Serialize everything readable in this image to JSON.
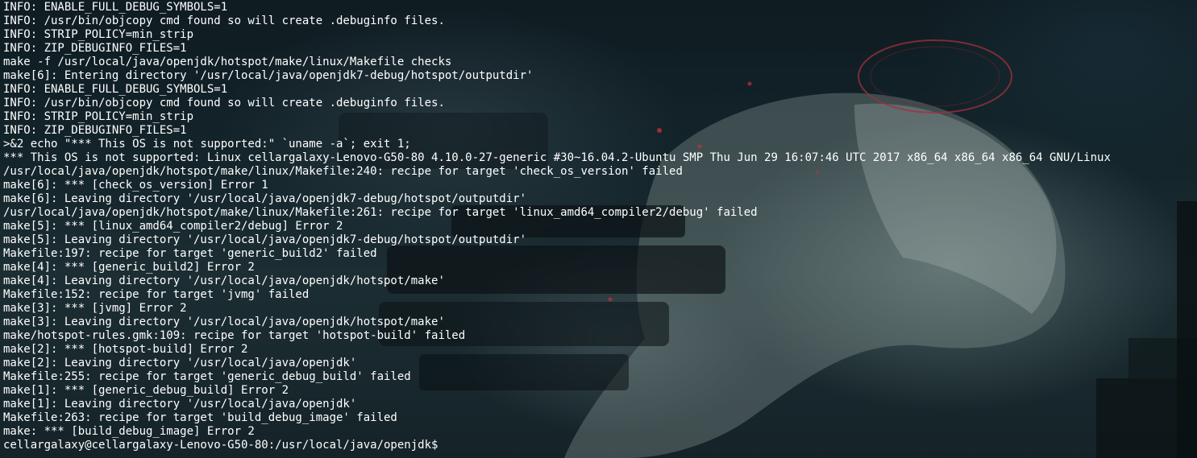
{
  "terminal": {
    "lines": [
      "INFO: ENABLE_FULL_DEBUG_SYMBOLS=1",
      "INFO: /usr/bin/objcopy cmd found so will create .debuginfo files.",
      "INFO: STRIP_POLICY=min_strip",
      "INFO: ZIP_DEBUGINFO_FILES=1",
      "make -f /usr/local/java/openjdk/hotspot/make/linux/Makefile checks",
      "make[6]: Entering directory '/usr/local/java/openjdk7-debug/hotspot/outputdir'",
      "INFO: ENABLE_FULL_DEBUG_SYMBOLS=1",
      "INFO: /usr/bin/objcopy cmd found so will create .debuginfo files.",
      "INFO: STRIP_POLICY=min_strip",
      "INFO: ZIP_DEBUGINFO_FILES=1",
      ">&2 echo \"*** This OS is not supported:\" `uname -a`; exit 1;",
      "*** This OS is not supported: Linux cellargalaxy-Lenovo-G50-80 4.10.0-27-generic #30~16.04.2-Ubuntu SMP Thu Jun 29 16:07:46 UTC 2017 x86_64 x86_64 x86_64 GNU/Linux",
      "/usr/local/java/openjdk/hotspot/make/linux/Makefile:240: recipe for target 'check_os_version' failed",
      "make[6]: *** [check_os_version] Error 1",
      "make[6]: Leaving directory '/usr/local/java/openjdk7-debug/hotspot/outputdir'",
      "/usr/local/java/openjdk/hotspot/make/linux/Makefile:261: recipe for target 'linux_amd64_compiler2/debug' failed",
      "make[5]: *** [linux_amd64_compiler2/debug] Error 2",
      "make[5]: Leaving directory '/usr/local/java/openjdk7-debug/hotspot/outputdir'",
      "Makefile:197: recipe for target 'generic_build2' failed",
      "make[4]: *** [generic_build2] Error 2",
      "make[4]: Leaving directory '/usr/local/java/openjdk/hotspot/make'",
      "Makefile:152: recipe for target 'jvmg' failed",
      "make[3]: *** [jvmg] Error 2",
      "make[3]: Leaving directory '/usr/local/java/openjdk/hotspot/make'",
      "make/hotspot-rules.gmk:109: recipe for target 'hotspot-build' failed",
      "make[2]: *** [hotspot-build] Error 2",
      "make[2]: Leaving directory '/usr/local/java/openjdk'",
      "Makefile:255: recipe for target 'generic_debug_build' failed",
      "make[1]: *** [generic_debug_build] Error 2",
      "make[1]: Leaving directory '/usr/local/java/openjdk'",
      "Makefile:263: recipe for target 'build_debug_image' failed",
      "make: *** [build_debug_image] Error 2"
    ],
    "prompt": "cellargalaxy@cellargalaxy-Lenovo-G50-80:/usr/local/java/openjdk$"
  },
  "colors": {
    "text": "#ffffff",
    "background": "#13242a"
  }
}
